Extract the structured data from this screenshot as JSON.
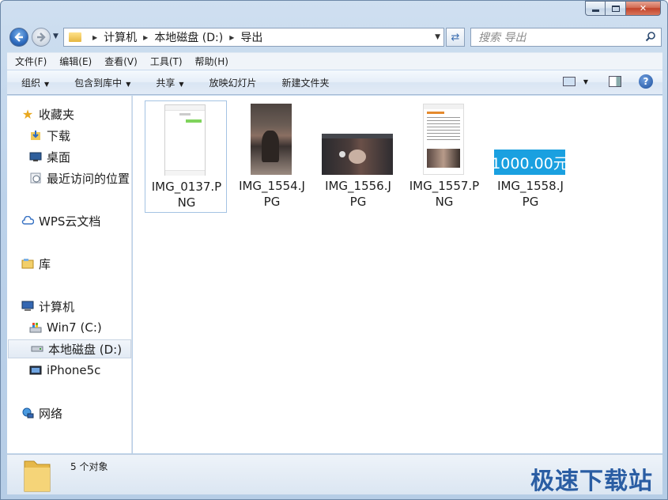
{
  "window": {
    "min_label": "",
    "max_label": "",
    "close_label": "✕"
  },
  "address": {
    "crumbs": [
      "计算机",
      "本地磁盘 (D:)",
      "导出"
    ]
  },
  "search": {
    "placeholder": "搜索 导出"
  },
  "menu": [
    "文件(F)",
    "编辑(E)",
    "查看(V)",
    "工具(T)",
    "帮助(H)"
  ],
  "commands": {
    "organize": "组织",
    "include_library": "包含到库中",
    "share": "共享",
    "slideshow": "放映幻灯片",
    "new_folder": "新建文件夹"
  },
  "nav": {
    "favorites": "收藏夹",
    "downloads": "下载",
    "desktop": "桌面",
    "recent": "最近访问的位置",
    "wps": "WPS云文档",
    "libraries": "库",
    "computer": "计算机",
    "win7": "Win7 (C:)",
    "local_d": "本地磁盘 (D:)",
    "iphone": "iPhone5c",
    "network": "网络"
  },
  "files": [
    {
      "line1": "IMG_0137.P",
      "line2": "NG"
    },
    {
      "line1": "IMG_1554.J",
      "line2": "PG"
    },
    {
      "line1": "IMG_1556.J",
      "line2": "PG"
    },
    {
      "line1": "IMG_1557.P",
      "line2": "NG"
    },
    {
      "line1": "IMG_1558.J",
      "line2": "PG",
      "thumb_text": "1000.00元"
    }
  ],
  "status": {
    "count": "5 个对象"
  },
  "watermark": "极速下载站",
  "colors": {
    "accent": "#2a5da3",
    "thumb_blue": "#1aa0e0"
  }
}
